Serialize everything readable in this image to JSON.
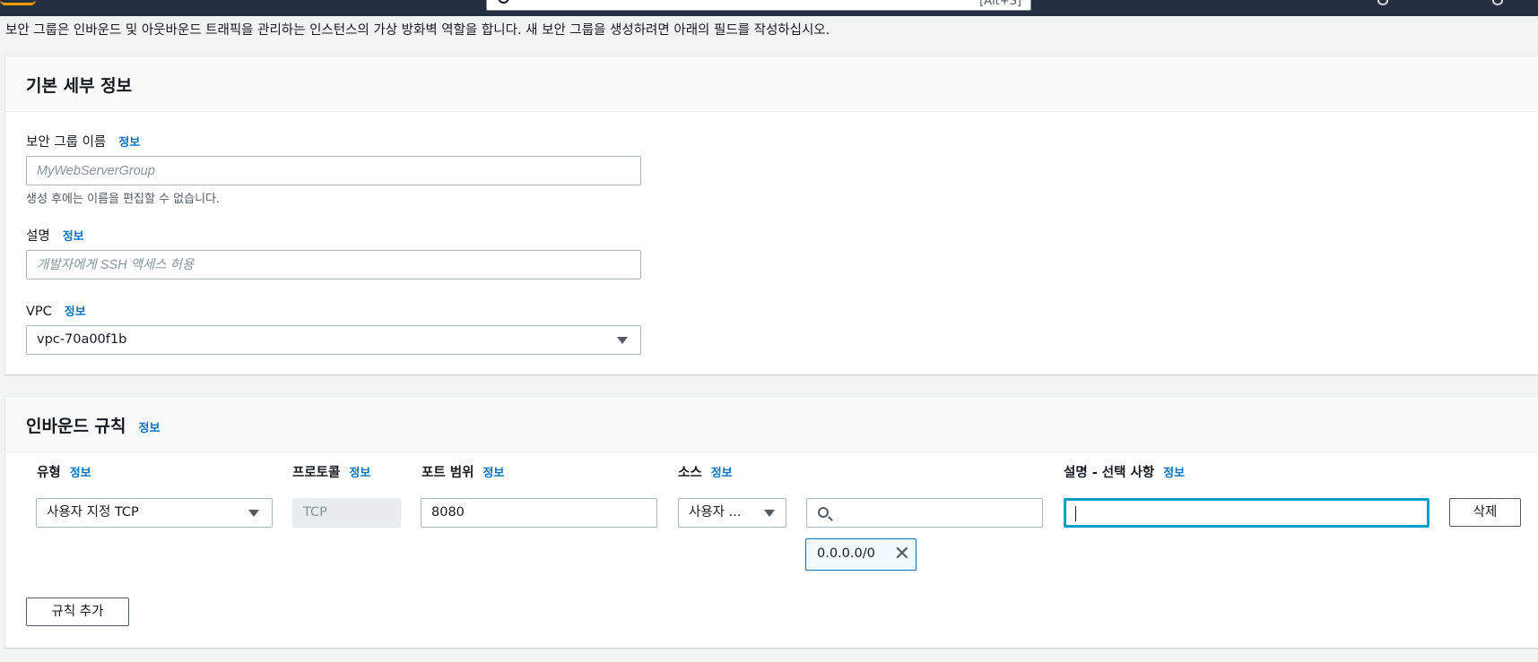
{
  "header": {
    "search_shortcut": "[Alt+S]"
  },
  "intro_text": "보안 그룹은 인바운드 및 아웃바운드 트래픽을 관리하는 인스턴스의 가상 방화벽 역할을 합니다. 새 보안 그룹을 생성하려면 아래의 필드를 작성하십시오.",
  "basic": {
    "title": "기본 세부 정보",
    "name_label": "보안 그룹 이름",
    "name_info": "정보",
    "name_placeholder": "MyWebServerGroup",
    "name_hint": "생성 후에는 이름을 편집할 수 없습니다.",
    "desc_label": "설명",
    "desc_info": "정보",
    "desc_placeholder": "개발자에게 SSH 액세스 허용",
    "vpc_label": "VPC",
    "vpc_info": "정보",
    "vpc_value": "vpc-70a00f1b"
  },
  "inbound": {
    "title": "인바운드 규칙",
    "title_info": "정보",
    "columns": {
      "type": "유형",
      "protocol": "프로토콜",
      "port_range": "포트 범위",
      "source": "소스",
      "description": "설명 - 선택 사항",
      "info": "정보"
    },
    "rule": {
      "type": "사용자 지정 TCP",
      "protocol": "TCP",
      "port_range": "8080",
      "source": "사용자 ...",
      "source_search": "",
      "cidr_token": "0.0.0.0/0",
      "description": ""
    },
    "delete_label": "삭제",
    "add_rule_label": "규칙 추가"
  }
}
